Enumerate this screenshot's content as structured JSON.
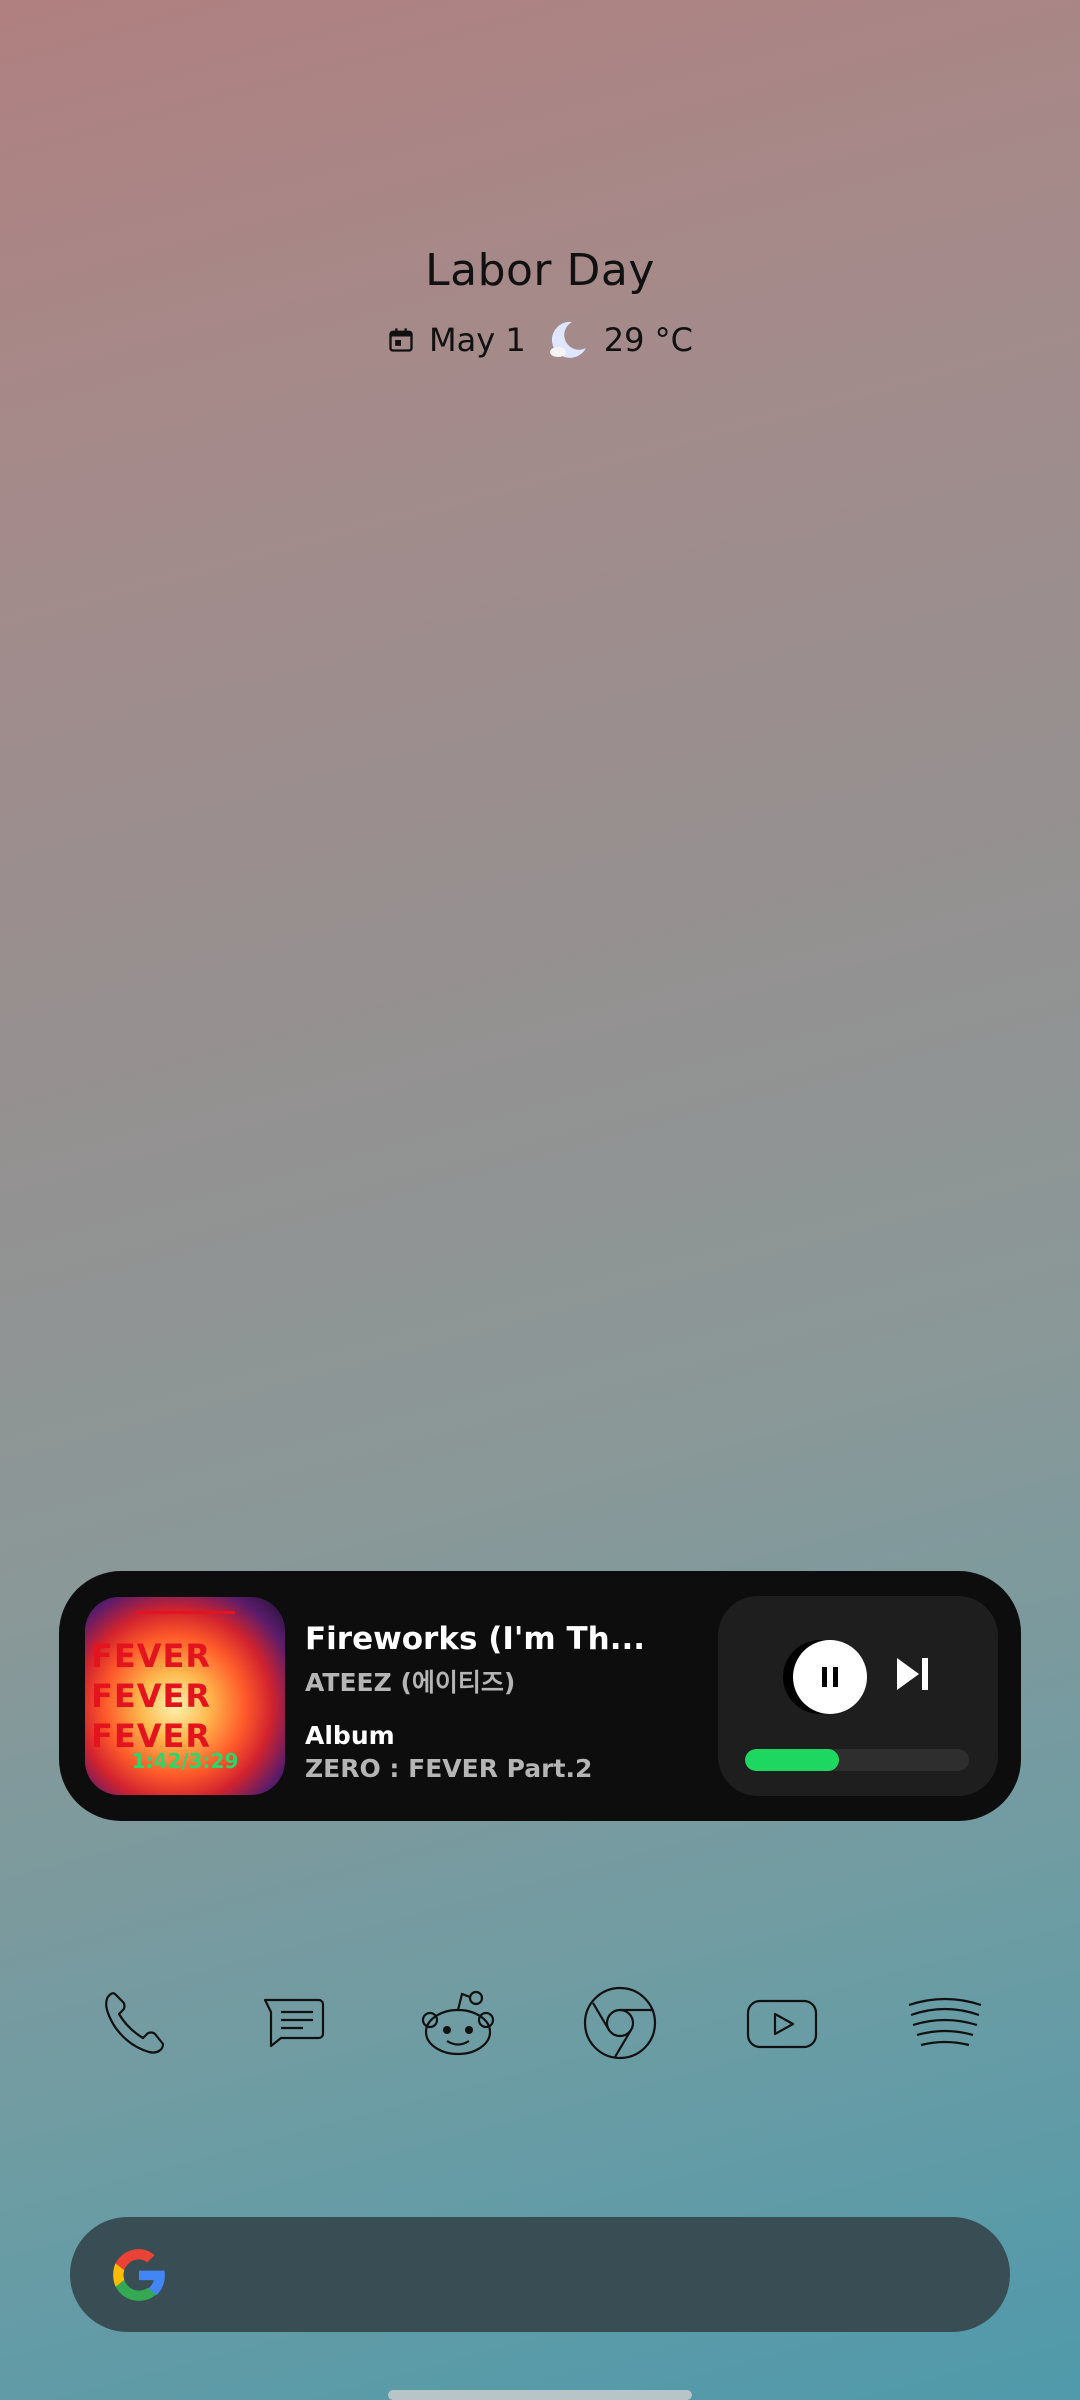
{
  "glance": {
    "event": "Labor Day",
    "date": "May 1",
    "temperature": "29 °C",
    "weather_icon": "moon-icon",
    "calendar_icon": "calendar-icon"
  },
  "music_widget": {
    "song_title": "Fireworks (I'm Th...",
    "artist": "ATEEZ (에이티즈)",
    "album_label": "Album",
    "album_name": "ZERO : FEVER Part.2",
    "art": {
      "fever_words": [
        "FEVER",
        "FEVER",
        "FEVER"
      ],
      "timer": "1:42/3:29"
    },
    "progress_fraction": 0.42,
    "accent_color": "#1ed760"
  },
  "dock": {
    "apps": [
      "phone-icon",
      "messages-icon",
      "reddit-icon",
      "chrome-icon",
      "youtube-icon",
      "spotify-icon"
    ]
  },
  "search": {
    "logo": "google-logo-icon"
  }
}
